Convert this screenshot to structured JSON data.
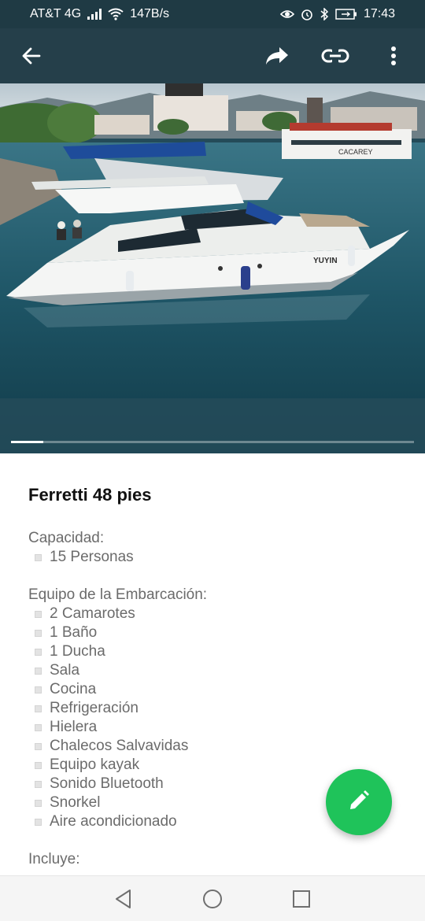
{
  "status_bar": {
    "carrier": "AT&T 4G",
    "speed": "147B/s",
    "time": "17:43"
  },
  "app_bar": {
    "back_icon": "arrow-left-icon",
    "share_icon": "forward-icon",
    "link_icon": "link-icon",
    "menu_icon": "more-vert-icon"
  },
  "media": {
    "progress_fraction": 0.08,
    "boat_name_on_hull": "YUYIN",
    "ferry_name": "CACAREY"
  },
  "listing": {
    "title": "Ferretti 48 pies",
    "capacity": {
      "label": "Capacidad:",
      "items": [
        "15 Personas"
      ]
    },
    "equipment": {
      "label": "Equipo de la Embarcación:",
      "items": [
        "2 Camarotes",
        "1 Baño",
        "1 Ducha",
        "Sala",
        "Cocina",
        "Refrigeración",
        "Hielera",
        "Chalecos Salvavidas",
        "Equipo kayak",
        "Sonido Bluetooth",
        "Snorkel",
        "Aire acondicionado"
      ]
    },
    "includes": {
      "label": "Incluye:"
    }
  },
  "fab": {
    "icon": "pencil-icon",
    "color": "#1fc35a"
  },
  "nav": {
    "back_icon": "nav-back-icon",
    "home_icon": "nav-home-icon",
    "recents_icon": "nav-recents-icon"
  }
}
